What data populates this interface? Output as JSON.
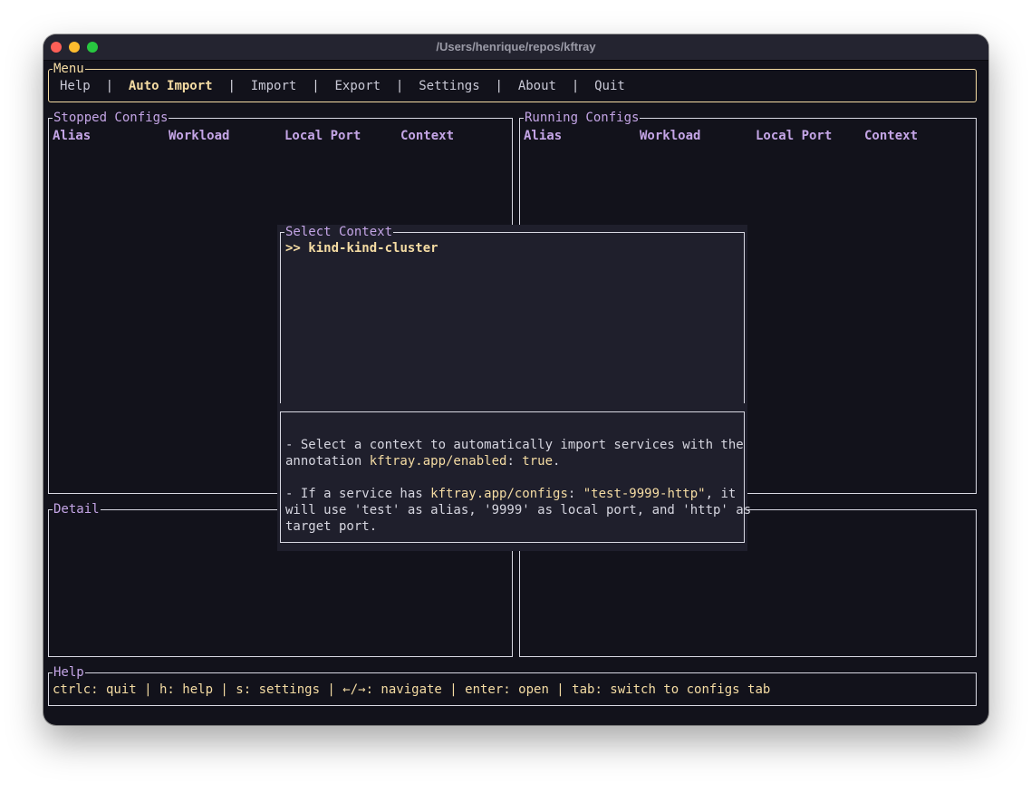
{
  "window": {
    "title": "/Users/henrique/repos/kftray"
  },
  "menu": {
    "title": "Menu",
    "items": [
      {
        "label": "Help"
      },
      {
        "label": "Auto Import"
      },
      {
        "label": "Import"
      },
      {
        "label": "Export"
      },
      {
        "label": "Settings"
      },
      {
        "label": "About"
      },
      {
        "label": "Quit"
      }
    ],
    "active_item": "Auto Import",
    "separator": "|"
  },
  "stopped": {
    "title": "Stopped Configs",
    "columns": [
      "Alias",
      "Workload",
      "Local Port",
      "Context"
    ]
  },
  "running": {
    "title": "Running Configs",
    "columns": [
      "Alias",
      "Workload",
      "Local Port",
      "Context"
    ]
  },
  "detail": {
    "title": "Detail"
  },
  "context_popup": {
    "title": "Select Context",
    "selector": ">>",
    "items": [
      "kind-kind-cluster"
    ],
    "info": {
      "l1": "- Select a context to automatically import services with the",
      "l2_a": "annotation ",
      "l2_b": "kftray.app/enabled",
      "l2_c": ": ",
      "l2_d": "true",
      "l2_e": ".",
      "l3_a": "- If a service has ",
      "l3_b": "kftray.app/configs",
      "l3_c": ": ",
      "l3_d": "\"test-9999-http\"",
      "l3_e": ", it",
      "l4": "will use 'test' as alias, '9999' as local port, and 'http' as",
      "l5": "target port."
    }
  },
  "help": {
    "title": "Help",
    "line": "ctrlc: quit | h: help | s: settings | ←/→: navigate | enter: open | tab: switch to configs tab"
  },
  "colors": {
    "background": "#12121b",
    "accent_yellow": "#f5dca3",
    "accent_purple": "#c4a5e6",
    "popup_bg": "#1f1f2c"
  }
}
